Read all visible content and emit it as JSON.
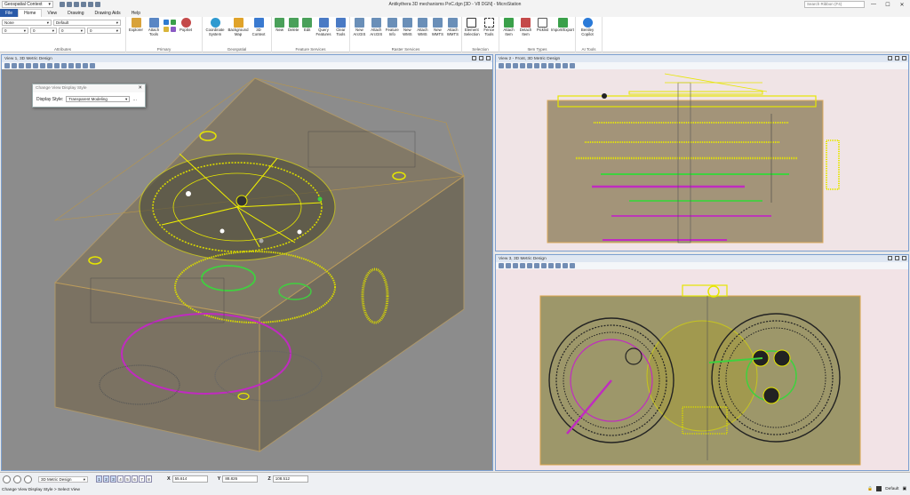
{
  "app": {
    "title": "Antikythera 3D mechanisms PoC.dgn [3D - V8 DGN] - MicroStation",
    "workspace": "Geospatial Context",
    "search_placeholder": "Search Ribbon (F4)"
  },
  "tabs": [
    "File",
    "Home",
    "View",
    "Drawing",
    "Drawing Aids",
    "Help"
  ],
  "ribbon": {
    "attributes": {
      "level": "None",
      "style": "Default",
      "color": "0",
      "weight": "0",
      "line_style": "0",
      "transparency": "0",
      "label": "Attributes"
    },
    "primary": {
      "label": "Primary",
      "buttons": [
        "Explorer",
        "Attach Tools",
        "PopSet"
      ]
    },
    "geospatial": {
      "label": "Geospatial",
      "buttons": [
        "Coordinate System",
        "Background Map",
        "3D Context"
      ]
    },
    "feature_services": {
      "label": "Feature Services",
      "buttons": [
        "New",
        "Delete",
        "Edit",
        "Query Features",
        "Clear Tools"
      ]
    },
    "raster_services": {
      "label": "Raster Services",
      "buttons": [
        "New ArcGIS",
        "Attach ArcGIS",
        "Feature Info",
        "New WMS",
        "Attach WMS",
        "New WMTS",
        "Attach WMTS"
      ]
    },
    "selection": {
      "label": "Selection",
      "buttons": [
        "Element Selection",
        "Fence Tools"
      ]
    },
    "item_types": {
      "label": "Item Types",
      "buttons": [
        "Attach Item",
        "Detach Item",
        "Picklist",
        "Import/Export"
      ]
    },
    "ai_tools": {
      "label": "AI Tools",
      "buttons": [
        "Bentley Copilot"
      ]
    }
  },
  "views": {
    "v1": {
      "title": "View 1, 3D Metric Design"
    },
    "v2": {
      "title": "View 2 - Front, 3D Metric Design"
    },
    "v3": {
      "title": "View 3, 3D Metric Design"
    }
  },
  "dialog": {
    "title": "Change View Display Style",
    "label": "Display Style:",
    "value": "Transparent Modeling"
  },
  "statusbar": {
    "model": "3D Metric Design",
    "view_numbers": [
      "1",
      "2",
      "3",
      "4",
      "5",
      "6",
      "7",
      "8"
    ],
    "x": {
      "label": "X",
      "value": "55.614"
    },
    "y": {
      "label": "Y",
      "value": "88.826"
    },
    "z": {
      "label": "Z",
      "value": "108.512"
    },
    "message": "Change View Display Style > Select View",
    "level": "Default"
  },
  "colors": {
    "accent": "#2a5aa8",
    "viewport_bg_1": "#8a8a8a",
    "viewport_bg_2": "#f2e3e6",
    "model_yellow": "#e6e600",
    "model_magenta": "#c02bc0",
    "model_green": "#3fd13f",
    "model_brown": "#8a6a3a"
  }
}
